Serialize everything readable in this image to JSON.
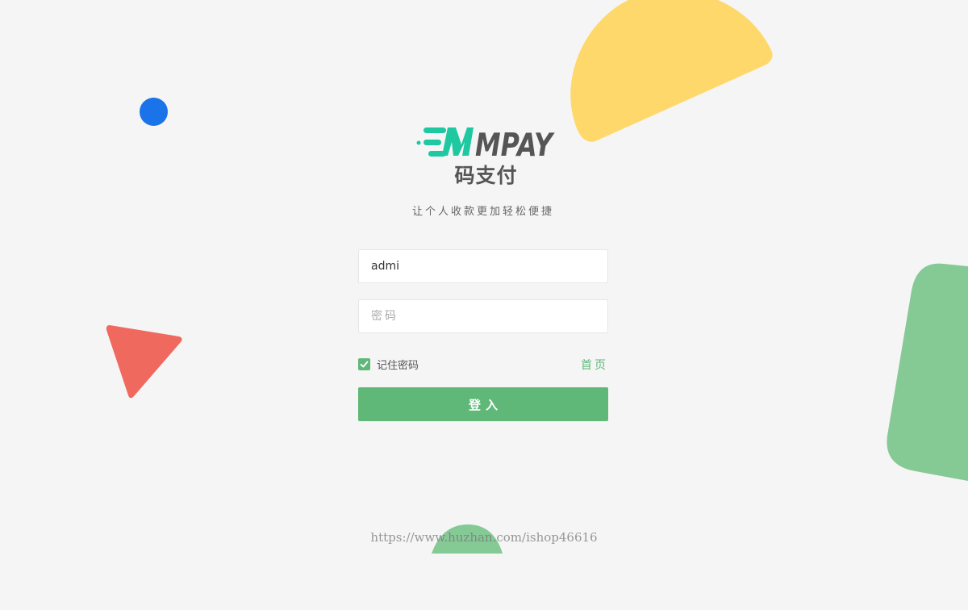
{
  "brand": {
    "logo_text": "MPAY",
    "name_cn": "码支付",
    "tagline": "让个人收款更加轻松便捷"
  },
  "form": {
    "username_value": "admi",
    "password_placeholder": "密码",
    "remember_label": "记住密码",
    "remember_checked": true,
    "home_link": "首页",
    "login_button": "登入"
  },
  "watermark": "https://www.huzhan.com/ishop46616",
  "colors": {
    "background": "#f5f5f5",
    "accent_green": "#5fb878",
    "logo_teal": "#1ec8a0",
    "logo_gray": "#555555",
    "deco_yellow": "#ffd86b",
    "deco_blue": "#1a73e8",
    "deco_red": "#f0695f",
    "deco_green": "#85c995"
  },
  "icons": {
    "checkbox": "check-icon"
  }
}
